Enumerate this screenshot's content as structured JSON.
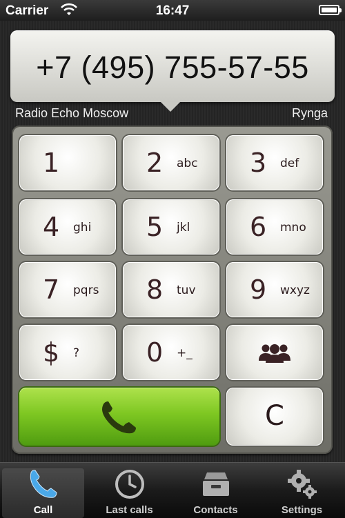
{
  "status_bar": {
    "carrier": "Carrier",
    "time": "16:47"
  },
  "display": {
    "number": "+7 (495) 755-57-55",
    "station": "Radio Echo Moscow",
    "provider": "Rynga"
  },
  "keypad": {
    "keys": [
      {
        "digit": "1",
        "letters": ""
      },
      {
        "digit": "2",
        "letters": "abc"
      },
      {
        "digit": "3",
        "letters": "def"
      },
      {
        "digit": "4",
        "letters": "ghi"
      },
      {
        "digit": "5",
        "letters": "jkl"
      },
      {
        "digit": "6",
        "letters": "mno"
      },
      {
        "digit": "7",
        "letters": "pqrs"
      },
      {
        "digit": "8",
        "letters": "tuv"
      },
      {
        "digit": "9",
        "letters": "wxyz"
      },
      {
        "digit": "$",
        "letters": "?"
      },
      {
        "digit": "0",
        "letters": "+_"
      }
    ],
    "clear_label": "C",
    "contacts_key_icon": "group-icon",
    "call_key_icon": "phone-icon",
    "call_color": "#7ec722"
  },
  "tab_bar": {
    "tabs": [
      {
        "label": "Call",
        "icon": "phone-icon",
        "active": true
      },
      {
        "label": "Last calls",
        "icon": "clock-icon",
        "active": false
      },
      {
        "label": "Contacts",
        "icon": "inbox-tray-icon",
        "active": false
      },
      {
        "label": "Settings",
        "icon": "gears-icon",
        "active": false
      }
    ]
  }
}
